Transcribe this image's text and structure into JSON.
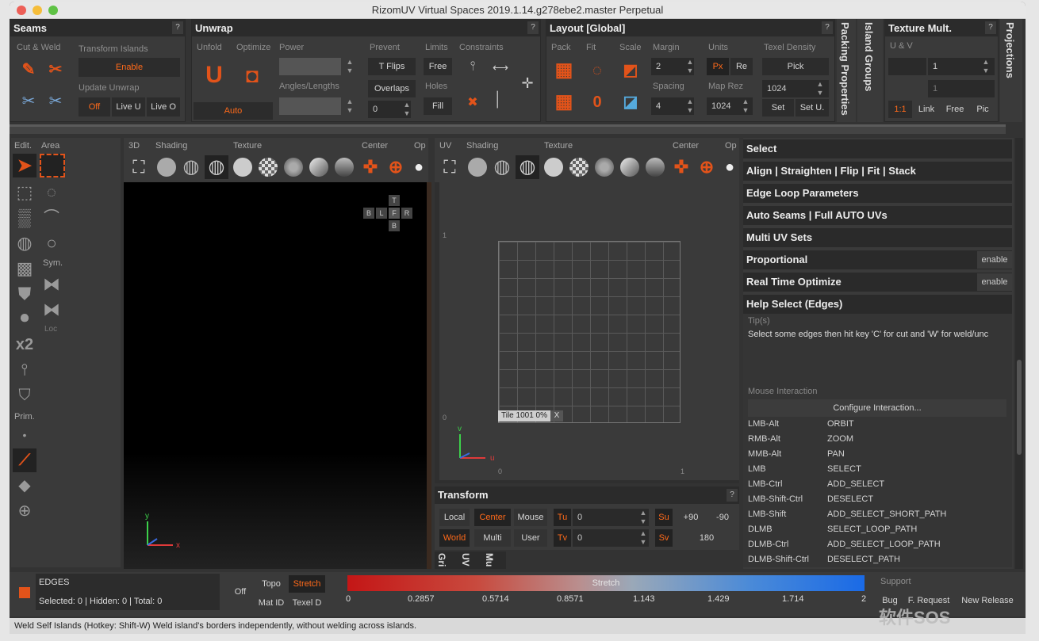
{
  "window": {
    "title": "RizomUV  Virtual Spaces 2019.1.14.g278ebe2.master Perpetual"
  },
  "seams": {
    "title": "Seams",
    "help": "?",
    "cut_weld": "Cut & Weld",
    "transform_islands": "Transform Islands",
    "enable": "Enable",
    "update_unwrap": "Update Unwrap",
    "off": "Off",
    "live_u": "Live U",
    "live_o": "Live O"
  },
  "unwrap": {
    "title": "Unwrap",
    "help": "?",
    "unfold": "Unfold",
    "optimize": "Optimize",
    "power": "Power",
    "prevent": "Prevent",
    "limits": "Limits",
    "constraints": "Constraints",
    "auto": "Auto",
    "angles_lengths": "Angles/Lengths",
    "t_flips": "T Flips",
    "overlaps": "Overlaps",
    "overlaps_value": "0",
    "free": "Free",
    "holes": "Holes",
    "fill": "Fill"
  },
  "layout": {
    "title": "Layout [Global]",
    "help": "?",
    "pack": "Pack",
    "fit": "Fit",
    "scale": "Scale",
    "margin": "Margin",
    "units": "Units",
    "texel_density": "Texel Density",
    "margin_value": "2",
    "spacing": "Spacing",
    "spacing_value": "4",
    "px": "Px",
    "re": "Re",
    "map_rez": "Map Rez",
    "map_rez_value": "1024",
    "pick": "Pick",
    "td_value": "1024",
    "set": "Set",
    "set_u": "Set U."
  },
  "vtabs": {
    "packing": "Packing Properties",
    "island_groups": "Island Groups",
    "projections": "Projections"
  },
  "texmult": {
    "title": "Texture Mult.",
    "help": "?",
    "uv": "U & V",
    "u_value": "1",
    "v_value": "1",
    "one_to_one": "1:1",
    "link": "Link",
    "free": "Free",
    "pic": "Pic"
  },
  "toolbox": {
    "edit": "Edit.",
    "area": "Area",
    "sym": "Sym.",
    "loc": "Loc",
    "prim": "Prim."
  },
  "viewport3d": {
    "label": "3D",
    "shading": "Shading",
    "texture": "Texture",
    "center": "Center",
    "op": "Op"
  },
  "viewcube": {
    "t": "T",
    "b": "B",
    "l": "L",
    "f": "F",
    "r": "R",
    "bottom": "B"
  },
  "viewportuv": {
    "label": "UV",
    "shading": "Shading",
    "texture": "Texture",
    "center": "Center",
    "op": "Op"
  },
  "uvgrid": {
    "y1": "1",
    "y0": "0",
    "x0": "0",
    "x1": "1",
    "tile": "Tile 1001 0%",
    "tile_close": "X"
  },
  "transform": {
    "title": "Transform",
    "help": "?",
    "local": "Local",
    "center": "Center",
    "mouse": "Mouse",
    "world": "World",
    "multi": "Multi",
    "user": "User",
    "tu": "Tu",
    "tu_value": "0",
    "tv": "Tv",
    "tv_value": "0",
    "su": "Su",
    "sv": "Sv",
    "plus90": "+90",
    "minus90": "-90",
    "r180": "180",
    "tab_gri": "Gri",
    "tab_uv": "UV",
    "tab_mu": "Mu"
  },
  "right": {
    "select": "Select",
    "align": "Align | Straighten | Flip | Fit | Stack",
    "edge_loop": "Edge Loop Parameters",
    "auto_seams": "Auto Seams | Full AUTO UVs",
    "multi_uv": "Multi UV Sets",
    "proportional": "Proportional",
    "real_time": "Real Time Optimize",
    "enable": "enable",
    "help_select": "Help Select (Edges)",
    "tips": "Tip(s)",
    "tip_text": "Select some edges then hit key 'C' for cut and 'W' for weld/unc",
    "mouse_interaction": "Mouse Interaction",
    "configure": "Configure Interaction...",
    "mouse": [
      {
        "k": "LMB-Alt",
        "v": "ORBIT"
      },
      {
        "k": "RMB-Alt",
        "v": "ZOOM"
      },
      {
        "k": "MMB-Alt",
        "v": "PAN"
      },
      {
        "k": "LMB",
        "v": "SELECT"
      },
      {
        "k": "LMB-Ctrl",
        "v": "ADD_SELECT"
      },
      {
        "k": "LMB-Shift-Ctrl",
        "v": "DESELECT"
      },
      {
        "k": "LMB-Shift",
        "v": "ADD_SELECT_SHORT_PATH"
      },
      {
        "k": "DLMB",
        "v": "SELECT_LOOP_PATH"
      },
      {
        "k": "DLMB-Ctrl",
        "v": "ADD_SELECT_LOOP_PATH"
      },
      {
        "k": "DLMB-Shift-Ctrl",
        "v": "DESELECT_PATH"
      }
    ]
  },
  "bottom": {
    "mode": "EDGES",
    "counts": "Selected: 0 | Hidden: 0 | Total: 0",
    "off": "Off",
    "topo": "Topo",
    "stretch": "Stretch",
    "mat_id": "Mat ID",
    "texel_d": "Texel D",
    "stretch_label": "Stretch",
    "ticks": [
      "0",
      "0.2857",
      "0.5714",
      "0.8571",
      "1.143",
      "1.429",
      "1.714",
      "2"
    ],
    "support": "Support",
    "bug": "Bug",
    "feature": "F. Request",
    "new_release": "New Release"
  },
  "status": "Weld Self Islands (Hotkey: Shift-W)  Weld island's borders independently, without welding across islands.",
  "watermark": "软件SOS",
  "colors": {
    "accent": "#e2531a",
    "panel": "#3a3a3a",
    "header": "#2b2b2b"
  }
}
